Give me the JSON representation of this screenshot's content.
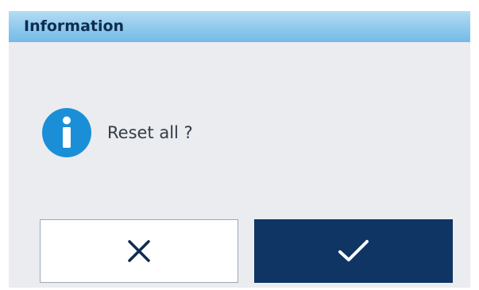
{
  "dialog": {
    "title": "Information",
    "message": "Reset all ?",
    "icon": "info-icon",
    "buttons": {
      "cancel_icon": "close-icon",
      "confirm_icon": "checkmark-icon"
    }
  },
  "colors": {
    "titlebar": "#8fc9ec",
    "title_text": "#0e2d50",
    "dialog_background": "#eaecef",
    "info_icon": "#1a8fd8",
    "confirm_button": "#0e3563",
    "cancel_button": "#ffffff"
  }
}
